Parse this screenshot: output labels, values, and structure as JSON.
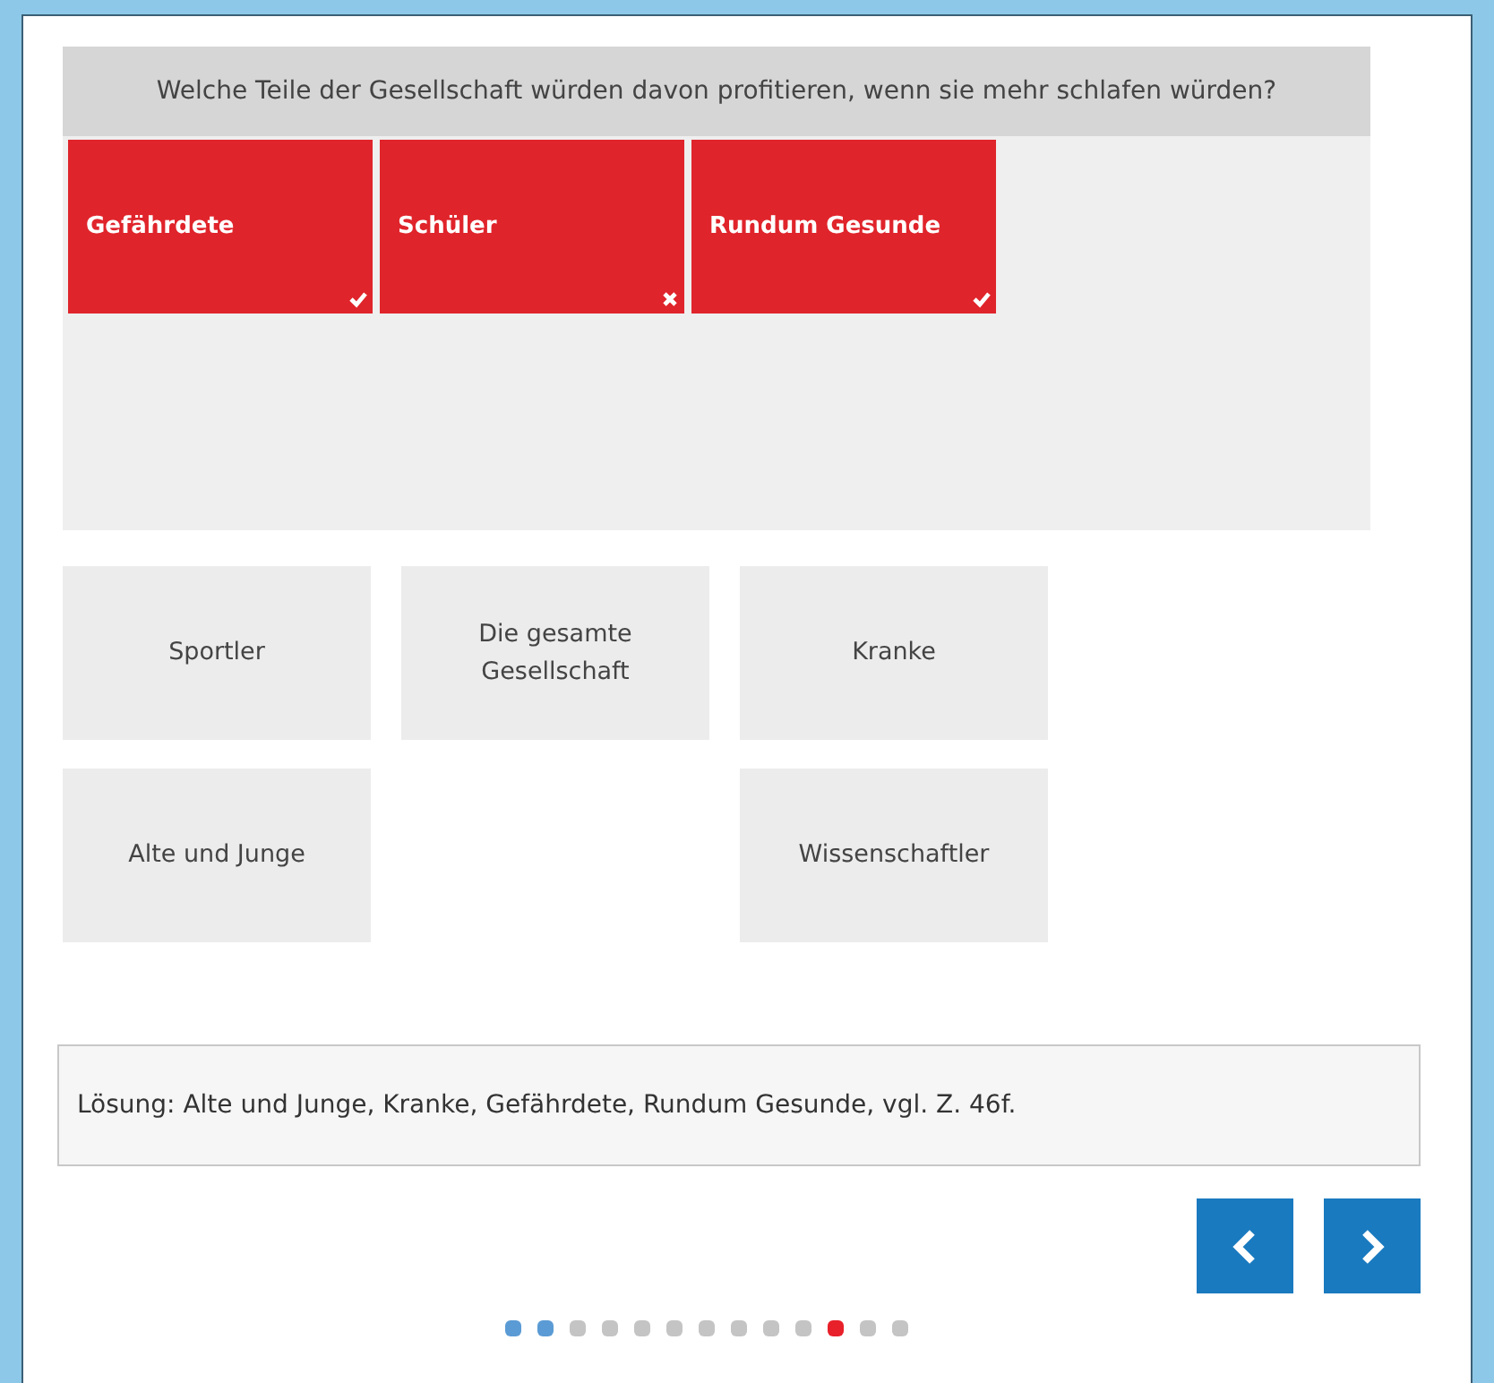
{
  "question": "Welche Teile der Gesellschaft würden davon profitieren, wenn sie mehr schlafen würden?",
  "placed": [
    {
      "label": "Gefährdete",
      "correct": true
    },
    {
      "label": "Schüler",
      "correct": false
    },
    {
      "label": "Rundum Gesunde",
      "correct": true
    }
  ],
  "options": [
    {
      "kind": "tile",
      "label": "Sportler"
    },
    {
      "kind": "tile",
      "label": "Die gesamte Gesellschaft"
    },
    {
      "kind": "tile",
      "label": "Kranke"
    },
    {
      "kind": "tile",
      "label": "Alte und Junge"
    },
    {
      "kind": "gap"
    },
    {
      "kind": "tile",
      "label": "Wissenschaftler"
    }
  ],
  "solution": "Lösung: Alte und Junge, Kranke, Gefährdete, Rundum Gesunde, vgl. Z. 46f.",
  "pager": [
    {
      "color": "#5b9bd5"
    },
    {
      "color": "#5b9bd5"
    },
    {
      "color": "#c4c4c4"
    },
    {
      "color": "#c4c4c4"
    },
    {
      "color": "#c4c4c4"
    },
    {
      "color": "#c4c4c4"
    },
    {
      "color": "#c4c4c4"
    },
    {
      "color": "#c4c4c4"
    },
    {
      "color": "#c4c4c4"
    },
    {
      "color": "#c4c4c4"
    },
    {
      "color": "#e8202a"
    },
    {
      "color": "#c4c4c4"
    },
    {
      "color": "#c4c4c4"
    }
  ]
}
